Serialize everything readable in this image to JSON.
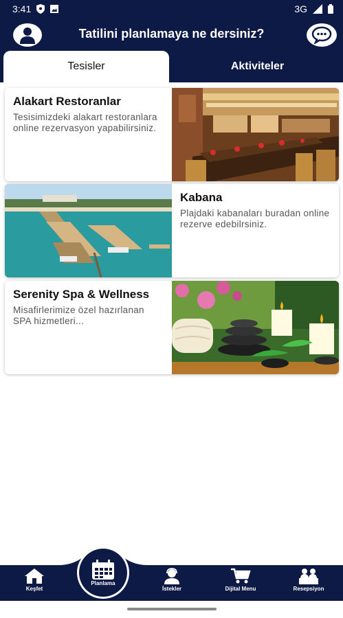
{
  "status_bar": {
    "time": "3:41",
    "network": "3G"
  },
  "header": {
    "title": "Tatilini planlamaya ne dersiniz?"
  },
  "tabs": [
    {
      "label": "Tesisler",
      "active": true
    },
    {
      "label": "Aktiviteler",
      "active": false
    }
  ],
  "cards": [
    {
      "title": "Alakart Restoranlar",
      "description": "Tesisimizdeki alakart restoranlara online rezervasyon yapabilirsiniz."
    },
    {
      "title": "Kabana",
      "description": "Plajdaki kabanaları buradan online rezerve edebilrsiniz."
    },
    {
      "title": "Serenity Spa & Wellness",
      "description": "Misafirlerimize özel hazırlanan SPA hizmetleri..."
    }
  ],
  "bottom_nav": [
    {
      "label": "Keşfet",
      "icon": "home-icon"
    },
    {
      "label": "Planlama",
      "icon": "calendar-icon"
    },
    {
      "label": "İstekler",
      "icon": "person-headset-icon"
    },
    {
      "label": "Dijital Menu",
      "icon": "cart-icon"
    },
    {
      "label": "Resepsiyon",
      "icon": "reception-icon"
    }
  ],
  "colors": {
    "primary": "#0d1a46",
    "background": "#ffffff"
  }
}
